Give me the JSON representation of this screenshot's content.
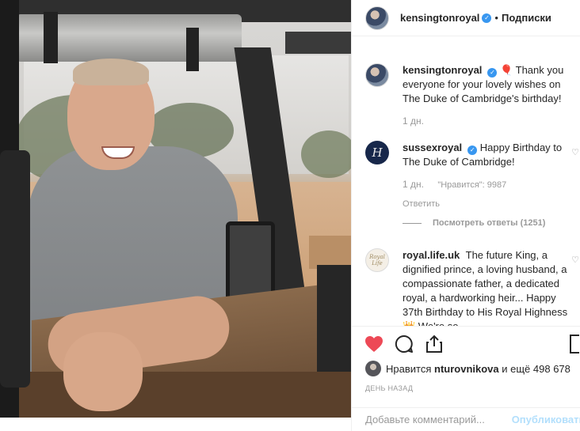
{
  "header": {
    "username": "kensingtonroyal",
    "separator": "•",
    "follow_label": "Подписки"
  },
  "comments": [
    {
      "username": "kensingtonroyal",
      "emoji": "🎈",
      "text": "Thank you everyone for your lovely wishes on The Duke of Cambridge's birthday!",
      "time": "1 дн."
    },
    {
      "username": "sussexroyal",
      "avatar_letter": "H",
      "text": "Happy Birthday to The Duke of Cambridge!",
      "time": "1 дн.",
      "likes": "\"Нравится\": 9987",
      "reply_label": "Ответить",
      "view_replies": "Посмотреть ответы (1251)"
    },
    {
      "username": "royal.life.uk",
      "avatar_text": "Royal Life",
      "text": "The future King, a dignified prince, a loving husband, a compassionate father, a dedicated royal, a hardworking heir... Happy 37th Birthday to His Royal Highness 👑 We're so"
    }
  ],
  "actions": {
    "like_icon": "heart-filled-icon",
    "comment_icon": "comment-icon",
    "share_icon": "share-icon",
    "save_icon": "bookmark-icon",
    "like_color": "#ed4956"
  },
  "likes": {
    "prefix": "Нравится",
    "user": "nturovnikova",
    "suffix": "и ещё 498 678"
  },
  "date": "ДЕНЬ НАЗАД",
  "add_comment": {
    "placeholder": "Добавьте комментарий...",
    "publish_label": "Опубликовать"
  }
}
